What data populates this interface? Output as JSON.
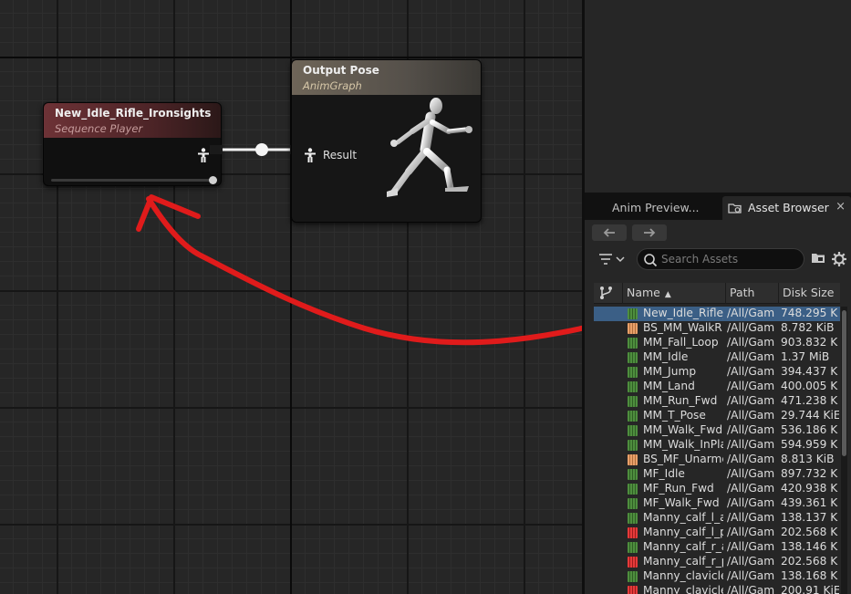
{
  "graph": {
    "nodes": {
      "sequence_player": {
        "title": "New_Idle_Rifle_Ironsights",
        "subtitle": "Sequence Player",
        "header_color": "#6d3236"
      },
      "output_pose": {
        "title": "Output Pose",
        "subtitle": "AnimGraph",
        "pin_label": "Result",
        "header_color": "#6e6558"
      }
    },
    "annotation_color": "#e01b1b"
  },
  "tabs": {
    "anim_preview": "Anim Preview...",
    "asset_browser": "Asset Browser",
    "close_glyph": "×"
  },
  "asset_browser": {
    "search_placeholder": "Search Assets",
    "columns": {
      "name": "Name",
      "path": "Path",
      "disk_size": "Disk Size",
      "sort_glyph": "▲"
    },
    "selection_color": "#3b5f86",
    "rows": [
      {
        "name": "New_Idle_Rifle_",
        "path": "/All/Gam",
        "size": "748.295 K",
        "type": "green",
        "selected": true
      },
      {
        "name": "BS_MM_WalkR",
        "path": "/All/Gam",
        "size": "8.782 KiB",
        "type": "orange"
      },
      {
        "name": "MM_Fall_Loop",
        "path": "/All/Gam",
        "size": "903.832 K",
        "type": "green"
      },
      {
        "name": "MM_Idle",
        "path": "/All/Gam",
        "size": "1.37 MiB",
        "type": "green"
      },
      {
        "name": "MM_Jump",
        "path": "/All/Gam",
        "size": "394.437 K",
        "type": "green"
      },
      {
        "name": "MM_Land",
        "path": "/All/Gam",
        "size": "400.005 K",
        "type": "green"
      },
      {
        "name": "MM_Run_Fwd",
        "path": "/All/Gam",
        "size": "471.238 K",
        "type": "green"
      },
      {
        "name": "MM_T_Pose",
        "path": "/All/Gam",
        "size": "29.744 KiE",
        "type": "green"
      },
      {
        "name": "MM_Walk_Fwd",
        "path": "/All/Gam",
        "size": "536.186 K",
        "type": "green"
      },
      {
        "name": "MM_Walk_InPla",
        "path": "/All/Gam",
        "size": "594.959 K",
        "type": "green"
      },
      {
        "name": "BS_MF_Unarme",
        "path": "/All/Gam",
        "size": "8.813 KiB",
        "type": "orange"
      },
      {
        "name": "MF_Idle",
        "path": "/All/Gam",
        "size": "897.732 K",
        "type": "green"
      },
      {
        "name": "MF_Run_Fwd",
        "path": "/All/Gam",
        "size": "420.938 K",
        "type": "green"
      },
      {
        "name": "MF_Walk_Fwd",
        "path": "/All/Gam",
        "size": "439.361 K",
        "type": "green"
      },
      {
        "name": "Manny_calf_l_a",
        "path": "/All/Gam",
        "size": "138.137 K",
        "type": "green"
      },
      {
        "name": "Manny_calf_l_p",
        "path": "/All/Gam",
        "size": "202.568 K",
        "type": "red"
      },
      {
        "name": "Manny_calf_r_a",
        "path": "/All/Gam",
        "size": "138.146 K",
        "type": "green"
      },
      {
        "name": "Manny_calf_r_p",
        "path": "/All/Gam",
        "size": "202.568 K",
        "type": "red"
      },
      {
        "name": "Manny_clavicle",
        "path": "/All/Gam",
        "size": "138.168 K",
        "type": "green"
      },
      {
        "name": "Manny_clavicle",
        "path": "/All/Gam",
        "size": "200.91 KiE",
        "type": "red"
      }
    ]
  }
}
